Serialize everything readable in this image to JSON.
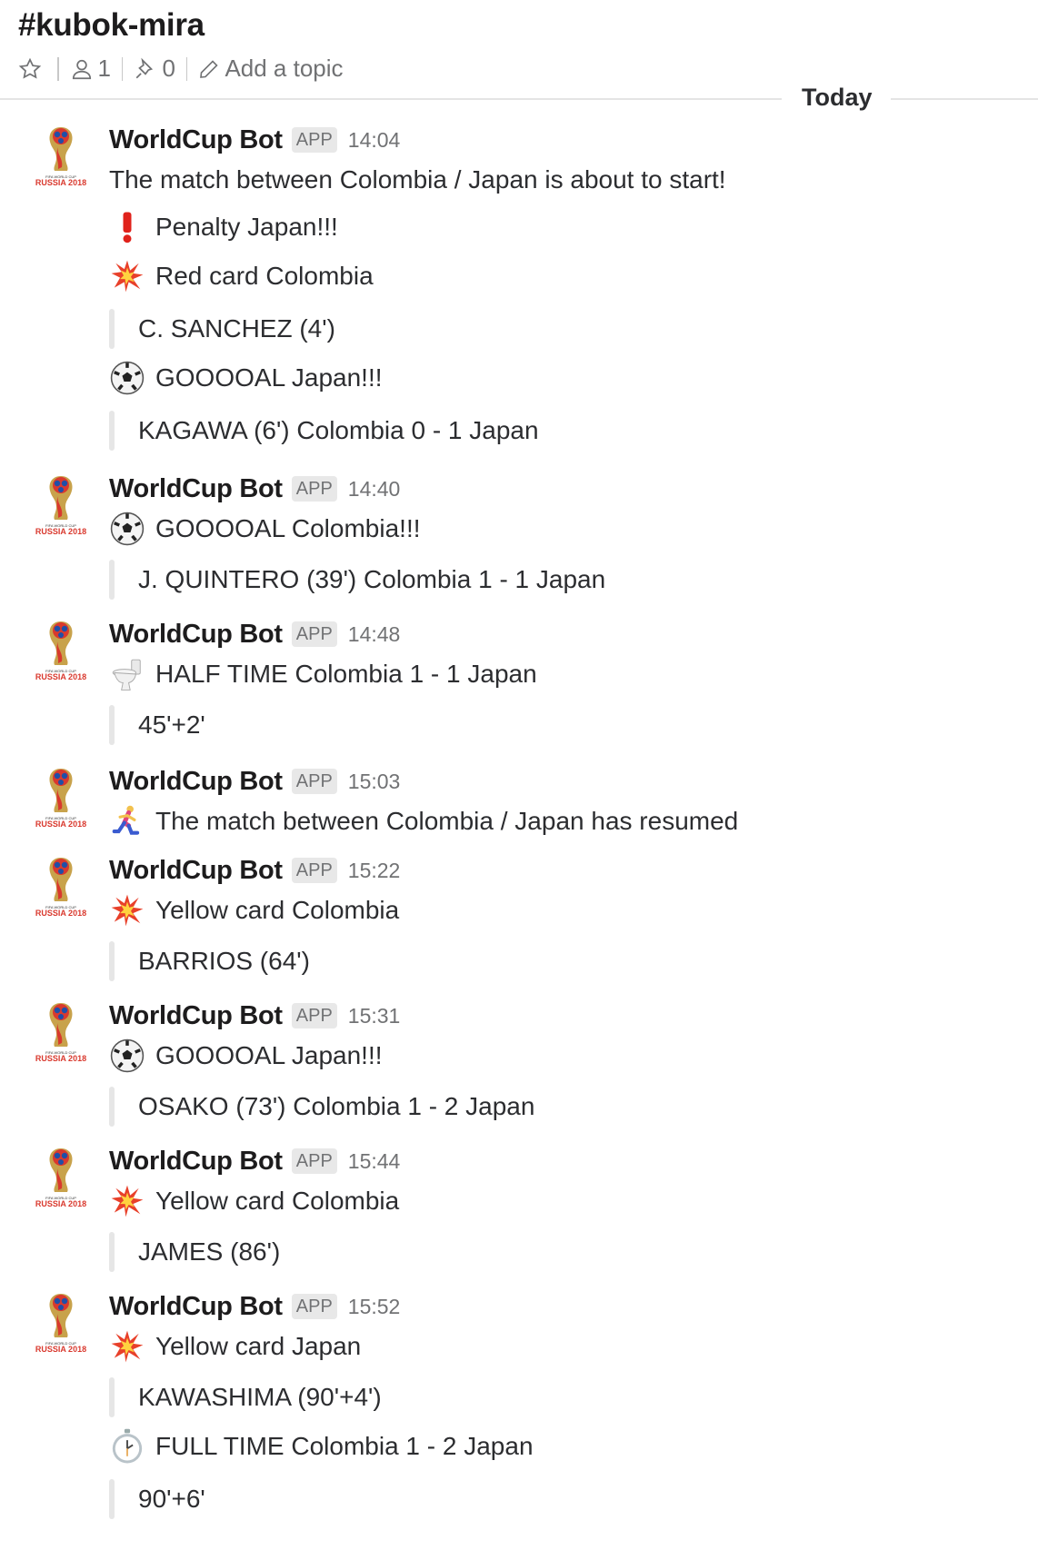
{
  "channel": {
    "name": "#kubok-mira",
    "member_count": "1",
    "pinned_count": "0",
    "topic_placeholder": "Add a topic"
  },
  "divider": {
    "label": "Today"
  },
  "bot": {
    "name": "WorldCup Bot",
    "badge": "APP",
    "avatar_caption": "RUSSIA 2018"
  },
  "messages": [
    {
      "time": "14:04",
      "lines": [
        {
          "type": "text",
          "text": "The match between Colombia / Japan is about to start!"
        },
        {
          "type": "event",
          "icon": "exclamation-icon",
          "text": "Penalty Japan!!!"
        },
        {
          "type": "event",
          "icon": "collision-icon",
          "text": "Red card Colombia"
        },
        {
          "type": "attachment",
          "text": "C. SANCHEZ (4')"
        },
        {
          "type": "event",
          "icon": "soccer-ball-icon",
          "text": "GOOOOAL Japan!!!"
        },
        {
          "type": "attachment",
          "text": "KAGAWA (6') Colombia 0 - 1 Japan"
        }
      ]
    },
    {
      "time": "14:40",
      "lines": [
        {
          "type": "event",
          "icon": "soccer-ball-icon",
          "text": "GOOOOAL Colombia!!!"
        },
        {
          "type": "attachment",
          "text": "J. QUINTERO (39') Colombia 1 - 1 Japan"
        }
      ]
    },
    {
      "time": "14:48",
      "lines": [
        {
          "type": "event",
          "icon": "toilet-icon",
          "text": "HALF TIME Colombia 1 - 1 Japan"
        },
        {
          "type": "attachment",
          "text": "45'+2'"
        }
      ]
    },
    {
      "time": "15:03",
      "lines": [
        {
          "type": "event",
          "icon": "runner-icon",
          "text": "The match between Colombia / Japan has resumed"
        }
      ]
    },
    {
      "time": "15:22",
      "lines": [
        {
          "type": "event",
          "icon": "collision-icon",
          "text": "Yellow card Colombia"
        },
        {
          "type": "attachment",
          "text": "BARRIOS (64')"
        }
      ]
    },
    {
      "time": "15:31",
      "lines": [
        {
          "type": "event",
          "icon": "soccer-ball-icon",
          "text": "GOOOOAL Japan!!!"
        },
        {
          "type": "attachment",
          "text": "OSAKO (73') Colombia 1 - 2 Japan"
        }
      ]
    },
    {
      "time": "15:44",
      "lines": [
        {
          "type": "event",
          "icon": "collision-icon",
          "text": "Yellow card Colombia"
        },
        {
          "type": "attachment",
          "text": "JAMES (86')"
        }
      ]
    },
    {
      "time": "15:52",
      "lines": [
        {
          "type": "event",
          "icon": "collision-icon",
          "text": "Yellow card Japan"
        },
        {
          "type": "attachment",
          "text": "KAWASHIMA (90'+4')"
        },
        {
          "type": "event",
          "icon": "stopwatch-icon",
          "text": "FULL TIME Colombia 1 - 2 Japan"
        },
        {
          "type": "attachment",
          "text": "90'+6'"
        }
      ]
    }
  ]
}
